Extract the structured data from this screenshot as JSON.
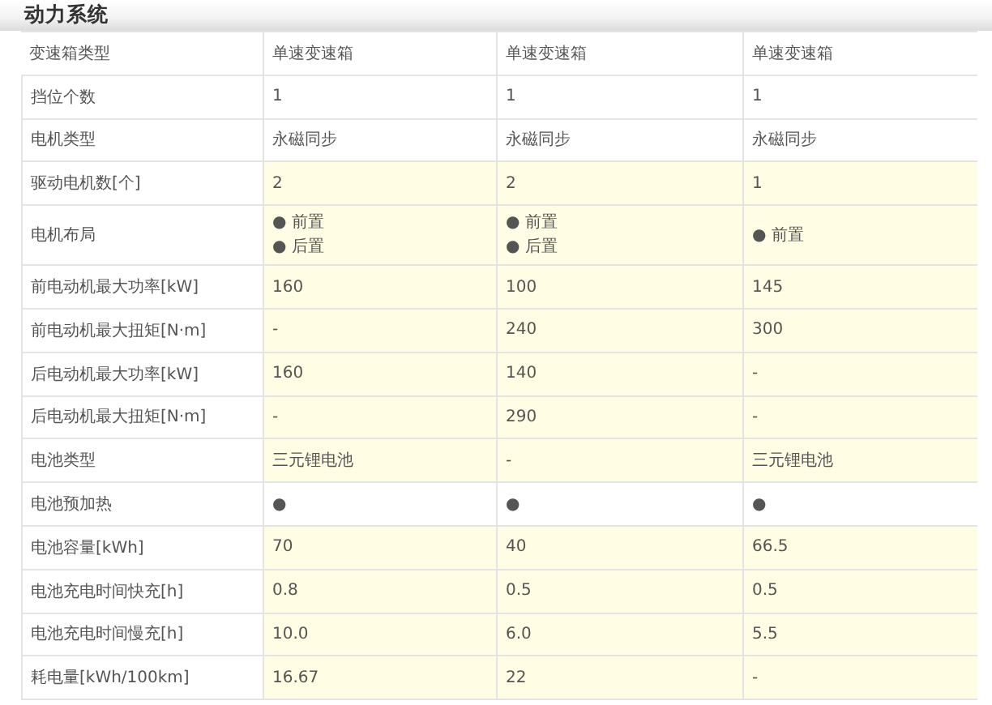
{
  "section_title": "动力系统",
  "rows": [
    {
      "label": "变速箱类型",
      "highlighted": false,
      "values": [
        "单速变速箱",
        "单速变速箱",
        "单速变速箱"
      ]
    },
    {
      "label": "挡位个数",
      "highlighted": false,
      "values": [
        "1",
        "1",
        "1"
      ]
    },
    {
      "label": "电机类型",
      "highlighted": false,
      "values": [
        "永磁同步",
        "永磁同步",
        "永磁同步"
      ]
    },
    {
      "label": "驱动电机数[个]",
      "highlighted": true,
      "values": [
        "2",
        "2",
        "1"
      ]
    },
    {
      "label": "电机布局",
      "highlighted": true,
      "values": [
        [
          "● 前置",
          "● 后置"
        ],
        [
          "● 前置",
          "● 后置"
        ],
        [
          "● 前置"
        ]
      ]
    },
    {
      "label": "前电动机最大功率[kW]",
      "highlighted": true,
      "values": [
        "160",
        "100",
        "145"
      ]
    },
    {
      "label": "前电动机最大扭矩[N·m]",
      "highlighted": true,
      "values": [
        "-",
        "240",
        "300"
      ]
    },
    {
      "label": "后电动机最大功率[kW]",
      "highlighted": true,
      "values": [
        "160",
        "140",
        "-"
      ]
    },
    {
      "label": "后电动机最大扭矩[N·m]",
      "highlighted": true,
      "values": [
        "-",
        "290",
        "-"
      ]
    },
    {
      "label": "电池类型",
      "highlighted": true,
      "values": [
        "三元锂电池",
        "-",
        "三元锂电池"
      ]
    },
    {
      "label": "电池预加热",
      "highlighted": false,
      "values": [
        "●",
        "●",
        "●"
      ]
    },
    {
      "label": "电池容量[kWh]",
      "highlighted": true,
      "values": [
        "70",
        "40",
        "66.5"
      ]
    },
    {
      "label": "电池充电时间快充[h]",
      "highlighted": true,
      "values": [
        "0.8",
        "0.5",
        "0.5"
      ]
    },
    {
      "label": "电池充电时间慢充[h]",
      "highlighted": true,
      "values": [
        "10.0",
        "6.0",
        "5.5"
      ]
    },
    {
      "label": "耗电量[kWh/100km]",
      "highlighted": true,
      "values": [
        "16.67",
        "22",
        "-"
      ]
    }
  ]
}
